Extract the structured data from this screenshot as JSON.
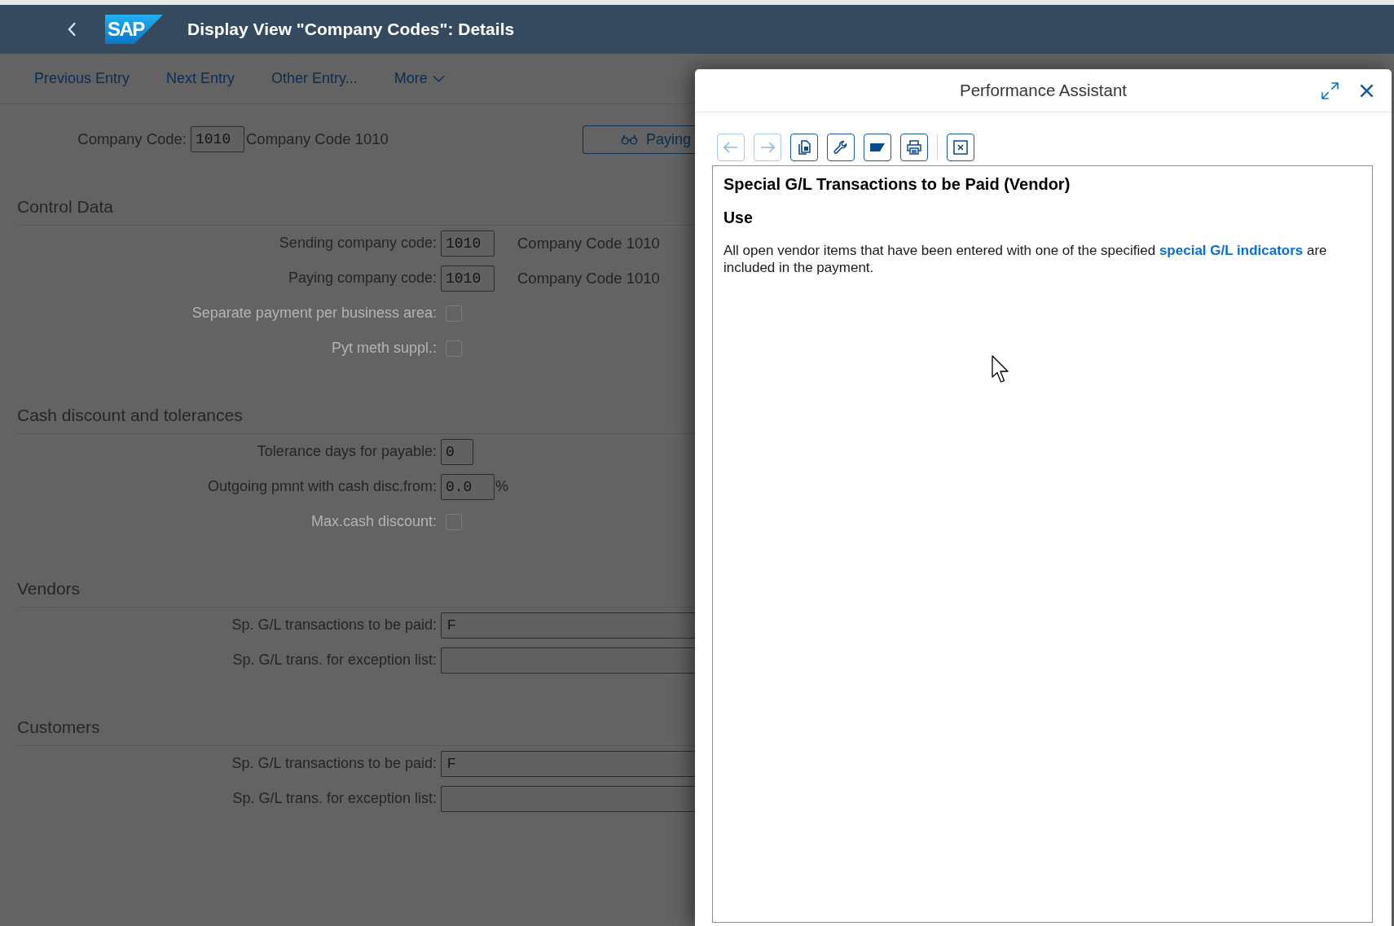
{
  "shell": {
    "logo": "SAP",
    "title": "Display View \"Company Codes\": Details"
  },
  "toolbar": {
    "items": [
      {
        "label": "Previous Entry",
        "kind": "link"
      },
      {
        "label": "Next Entry",
        "kind": "link"
      },
      {
        "label": "Other Entry...",
        "kind": "link"
      },
      {
        "label": "More",
        "kind": "menu"
      }
    ]
  },
  "header": {
    "label": "Company Code:",
    "value": "1010",
    "description": "Company Code 1010",
    "button": {
      "label": "Paying"
    }
  },
  "sections": [
    {
      "title": "Control Data",
      "fields": [
        {
          "kind": "input",
          "label": "Sending company code:",
          "value": "1010",
          "description": "Company Code 1010",
          "disabled": false
        },
        {
          "kind": "input",
          "label": "Paying company code:",
          "value": "1010",
          "description": "Company Code 1010",
          "disabled": false
        },
        {
          "kind": "checkbox",
          "label": "Separate payment per business area:",
          "checked": false,
          "disabled": true
        },
        {
          "kind": "checkbox",
          "label": "Pyt meth suppl.:",
          "checked": false,
          "disabled": true
        }
      ]
    },
    {
      "title": "Cash discount and tolerances",
      "fields": [
        {
          "kind": "input",
          "label": "Tolerance days for payable:",
          "value": "0",
          "disabled": false
        },
        {
          "kind": "input",
          "label": "Outgoing pmnt with cash disc.from:",
          "value": "0.0",
          "unit": "%",
          "disabled": false
        },
        {
          "kind": "checkbox",
          "label": "Max.cash discount:",
          "checked": false,
          "disabled": true
        }
      ]
    },
    {
      "title": "Vendors",
      "fields": [
        {
          "kind": "wide-input",
          "label": "Sp. G/L transactions to be paid:",
          "value": "F",
          "disabled": false
        },
        {
          "kind": "wide-input",
          "label": "Sp. G/L trans. for exception list:",
          "disabled": false
        }
      ]
    },
    {
      "title": "Customers",
      "fields": [
        {
          "kind": "wide-input",
          "label": "Sp. G/L transactions to be paid:",
          "value": "F",
          "disabled": false
        },
        {
          "kind": "wide-input",
          "label": "Sp. G/L trans. for exception list:",
          "disabled": false
        }
      ]
    }
  ],
  "dialog": {
    "title": "Performance Assistant",
    "tools": [
      {
        "kind": "back",
        "disabled": true
      },
      {
        "kind": "forward",
        "disabled": true
      },
      {
        "kind": "document",
        "disabled": false
      },
      {
        "kind": "wrench",
        "disabled": false
      },
      {
        "kind": "flag",
        "disabled": false
      },
      {
        "kind": "print",
        "disabled": false
      },
      {
        "kind": "close-view",
        "disabled": false
      }
    ],
    "heading": "Special G/L Transactions to be Paid (Vendor)",
    "subheading": "Use",
    "text": {
      "before": "All open vendor items that have been entered with one of the specified ",
      "link": "special G/L indicators",
      "after": " are included in the payment."
    }
  }
}
